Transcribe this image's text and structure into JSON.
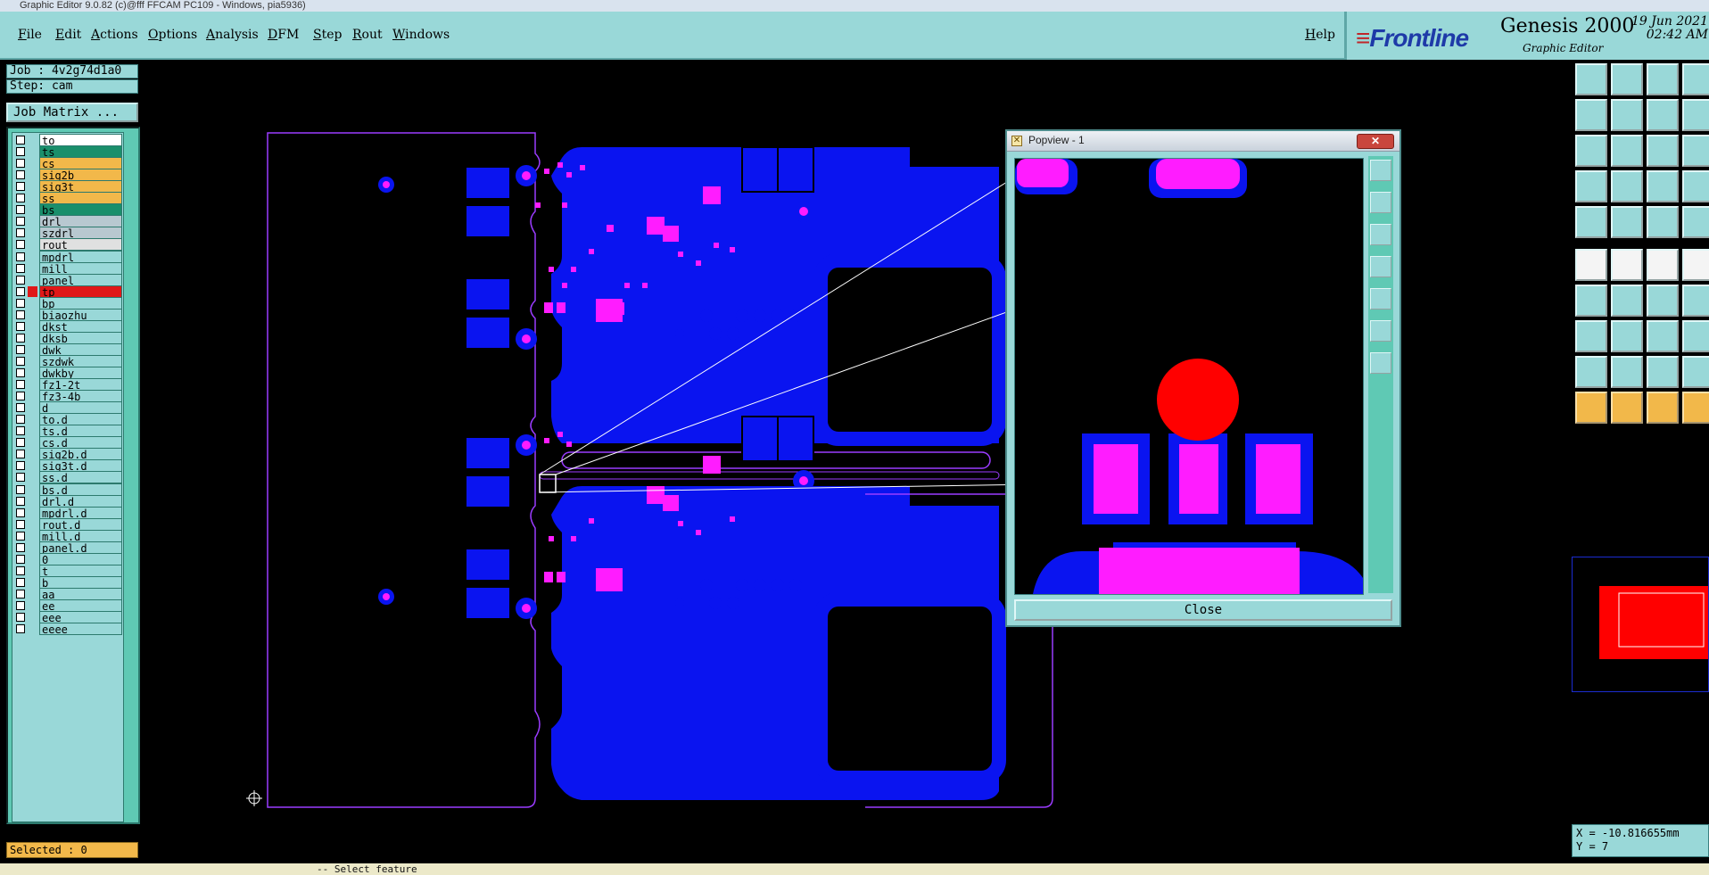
{
  "window": {
    "title": "Graphic Editor 9.0.82 (c)@fff FFCAM PC109 - Windows, pia5936)"
  },
  "menu": {
    "items": [
      "File",
      "Edit",
      "Actions",
      "Options",
      "Analysis",
      "DFM",
      "Step",
      "Rout",
      "Windows"
    ],
    "help": "Help"
  },
  "brand": {
    "logo": "Frontline",
    "product": "Genesis 2000",
    "subtitle": "Graphic Editor",
    "date": "19 Jun 2021",
    "time": "02:42 AM"
  },
  "job": {
    "label": "Job : 4v2g74d1a0",
    "step": "Step: cam"
  },
  "job_matrix_button": "Job Matrix ...",
  "layers": [
    {
      "name": "to",
      "color": "#ffffff"
    },
    {
      "name": "ts",
      "color": "#1a8f6b"
    },
    {
      "name": "cs",
      "color": "#f2b84a"
    },
    {
      "name": "sig2b",
      "color": "#f2b84a"
    },
    {
      "name": "sig3t",
      "color": "#f2b84a"
    },
    {
      "name": "ss",
      "color": "#f2b84a"
    },
    {
      "name": "bs",
      "color": "#1a8f6b"
    },
    {
      "name": "drl",
      "color": "#b8c8d0"
    },
    {
      "name": "szdrl",
      "color": "#b8c8d0"
    },
    {
      "name": "rout",
      "color": "#e0e0e0"
    },
    {
      "name": "mpdrl",
      "color": "#99d8d8"
    },
    {
      "name": "mill",
      "color": "#99d8d8"
    },
    {
      "name": "panel",
      "color": "#99d8d8"
    },
    {
      "name": "tp",
      "color": "#e01818",
      "active": true
    },
    {
      "name": "bp",
      "color": "#99d8d8"
    },
    {
      "name": "biaozhu",
      "color": "#99d8d8"
    },
    {
      "name": "dkst",
      "color": "#99d8d8"
    },
    {
      "name": "dksb",
      "color": "#99d8d8"
    },
    {
      "name": "dwk",
      "color": "#99d8d8"
    },
    {
      "name": "szdwk",
      "color": "#99d8d8"
    },
    {
      "name": "dwkby",
      "color": "#99d8d8"
    },
    {
      "name": "fz1-2t",
      "color": "#99d8d8"
    },
    {
      "name": "fz3-4b",
      "color": "#99d8d8"
    },
    {
      "name": "d",
      "color": "#99d8d8"
    },
    {
      "name": "to.d",
      "color": "#99d8d8"
    },
    {
      "name": "ts.d",
      "color": "#99d8d8"
    },
    {
      "name": "cs.d",
      "color": "#99d8d8"
    },
    {
      "name": "sig2b.d",
      "color": "#99d8d8"
    },
    {
      "name": "sig3t.d",
      "color": "#99d8d8"
    },
    {
      "name": "ss.d",
      "color": "#99d8d8"
    },
    {
      "name": "bs.d",
      "color": "#99d8d8"
    },
    {
      "name": "drl.d",
      "color": "#99d8d8"
    },
    {
      "name": "mpdrl.d",
      "color": "#99d8d8"
    },
    {
      "name": "rout.d",
      "color": "#99d8d8"
    },
    {
      "name": "mill.d",
      "color": "#99d8d8"
    },
    {
      "name": "panel.d",
      "color": "#99d8d8"
    },
    {
      "name": "0",
      "color": "#99d8d8"
    },
    {
      "name": "t",
      "color": "#99d8d8"
    },
    {
      "name": "b",
      "color": "#99d8d8"
    },
    {
      "name": "aa",
      "color": "#99d8d8"
    },
    {
      "name": "ee",
      "color": "#99d8d8"
    },
    {
      "name": "eee",
      "color": "#99d8d8"
    },
    {
      "name": "eeee",
      "color": "#99d8d8"
    }
  ],
  "status": {
    "selected": "Selected : 0",
    "bottom": "--   Select feature"
  },
  "popview": {
    "title": "Popview - 1",
    "close_label": "Close"
  },
  "coords": {
    "x": "X = -10.816655mm",
    "y": "Y = 7"
  },
  "colors": {
    "board_fill": "#0a14f0",
    "pad": "#ff1cff",
    "outline": "#9b3cff",
    "highlight": "#ff0000",
    "panel_bg": "#99d8d8"
  }
}
